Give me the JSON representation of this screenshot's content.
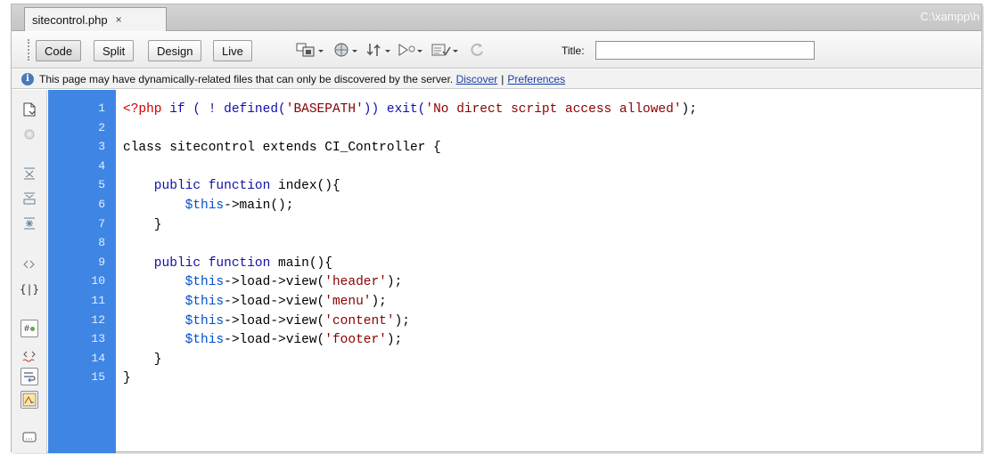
{
  "tab": {
    "filename": "sitecontrol.php",
    "close_glyph": "×",
    "path": "C:\\xampp\\h"
  },
  "toolbar": {
    "buttons": [
      "Code",
      "Split",
      "Design",
      "Live"
    ],
    "icons": [
      "multiscreen-icon",
      "browser-preview-icon",
      "file-management-icon",
      "debug-icon",
      "validate-icon",
      "refresh-icon"
    ],
    "title_label": "Title:",
    "title_value": ""
  },
  "infobar": {
    "message": "This page may have dynamically-related files that can only be discovered by the server.",
    "discover": "Discover",
    "separator": "|",
    "preferences": "Preferences"
  },
  "tools": [
    "open-documents-icon",
    "show-code-navigator-icon",
    "collapse-full-tag-icon",
    "collapse-selection-icon",
    "expand-all-icon",
    "select-parent-tag-icon",
    "balance-braces-icon",
    "line-numbers-icon",
    "highlight-invalid-code-icon",
    "syntax-coloring-icon",
    "word-wrap-icon",
    "apply-source-formatting-icon",
    "comment-icon"
  ],
  "line_numbers": [
    "1",
    "2",
    "3",
    "4",
    "5",
    "6",
    "7",
    "8",
    "9",
    "10",
    "11",
    "12",
    "13",
    "14",
    "15"
  ],
  "code_lines": [
    [
      {
        "t": "<?php",
        "c": "php"
      },
      {
        "t": " if ( ! defined(",
        "c": "kw"
      },
      {
        "t": "'BASEPATH'",
        "c": "str"
      },
      {
        "t": ")) exit(",
        "c": "kw"
      },
      {
        "t": "'No direct script access allowed'",
        "c": "str"
      },
      {
        "t": ");",
        "c": "pl"
      }
    ],
    [],
    [
      {
        "t": "class sitecontrol extends CI_Controller {",
        "c": "pl"
      }
    ],
    [],
    [
      {
        "t": "    public function ",
        "c": "kw"
      },
      {
        "t": "index(){",
        "c": "pl"
      }
    ],
    [
      {
        "t": "        ",
        "c": "pl"
      },
      {
        "t": "$this",
        "c": "var"
      },
      {
        "t": "->main();",
        "c": "pl"
      }
    ],
    [
      {
        "t": "    }",
        "c": "pl"
      }
    ],
    [],
    [
      {
        "t": "    public function ",
        "c": "kw"
      },
      {
        "t": "main(){",
        "c": "pl"
      }
    ],
    [
      {
        "t": "        ",
        "c": "pl"
      },
      {
        "t": "$this",
        "c": "var"
      },
      {
        "t": "->load->view(",
        "c": "pl"
      },
      {
        "t": "'header'",
        "c": "str"
      },
      {
        "t": ");",
        "c": "pl"
      }
    ],
    [
      {
        "t": "        ",
        "c": "pl"
      },
      {
        "t": "$this",
        "c": "var"
      },
      {
        "t": "->load->view(",
        "c": "pl"
      },
      {
        "t": "'menu'",
        "c": "str"
      },
      {
        "t": ");",
        "c": "pl"
      }
    ],
    [
      {
        "t": "        ",
        "c": "pl"
      },
      {
        "t": "$this",
        "c": "var"
      },
      {
        "t": "->load->view(",
        "c": "pl"
      },
      {
        "t": "'content'",
        "c": "str"
      },
      {
        "t": ");",
        "c": "pl"
      }
    ],
    [
      {
        "t": "        ",
        "c": "pl"
      },
      {
        "t": "$this",
        "c": "var"
      },
      {
        "t": "->load->view(",
        "c": "pl"
      },
      {
        "t": "'footer'",
        "c": "str"
      },
      {
        "t": ");",
        "c": "pl"
      }
    ],
    [
      {
        "t": "    }",
        "c": "pl"
      }
    ],
    [
      {
        "t": "}",
        "c": "pl"
      }
    ]
  ],
  "colors": {
    "gutter": "#3f86e4",
    "keyword": "#1010a8",
    "string": "#8b0000",
    "php_tag": "#cc0000",
    "variable": "#0050cc"
  }
}
